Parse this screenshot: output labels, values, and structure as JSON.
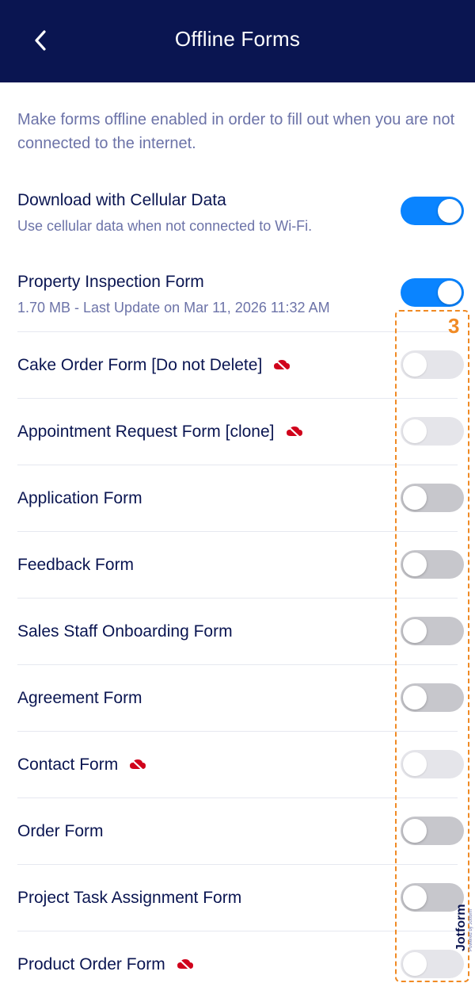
{
  "header": {
    "title": "Offline Forms"
  },
  "intro": "Make forms offline enabled in order to fill out when you are not connected to the internet.",
  "cellular": {
    "title": "Download with Cellular Data",
    "subtitle": "Use cellular data when not connected to Wi-Fi.",
    "enabled": true
  },
  "forms": [
    {
      "name": "Property Inspection Form",
      "subtitle": "1.70 MB - Last Update on Mar 11, 2026 11:32 AM",
      "state": "on",
      "offline_unavailable": false
    },
    {
      "name": "Cake Order Form [Do not Delete]",
      "state": "disabled",
      "offline_unavailable": true
    },
    {
      "name": "Appointment Request Form [clone]",
      "state": "disabled",
      "offline_unavailable": true
    },
    {
      "name": "Application Form",
      "state": "off",
      "offline_unavailable": false
    },
    {
      "name": "Feedback Form",
      "state": "off",
      "offline_unavailable": false
    },
    {
      "name": "Sales Staff Onboarding Form",
      "state": "off",
      "offline_unavailable": false
    },
    {
      "name": "Agreement Form",
      "state": "off",
      "offline_unavailable": false
    },
    {
      "name": "Contact Form",
      "state": "disabled",
      "offline_unavailable": true
    },
    {
      "name": "Order Form",
      "state": "off",
      "offline_unavailable": false
    },
    {
      "name": "Project Task Assignment Form",
      "state": "off",
      "offline_unavailable": false
    },
    {
      "name": "Product Order Form",
      "state": "disabled",
      "offline_unavailable": true
    }
  ],
  "annotation": {
    "label": "3"
  },
  "watermark": {
    "brand": "Jotform",
    "tagline": "Powered by Jotform"
  },
  "colors": {
    "header_bg": "#0a1551",
    "toggle_on": "#0a84ff",
    "toggle_off": "#c7c7cc",
    "toggle_disabled": "#e5e5ea",
    "offline_icon": "#d0021b",
    "annotation": "#f08a24"
  }
}
